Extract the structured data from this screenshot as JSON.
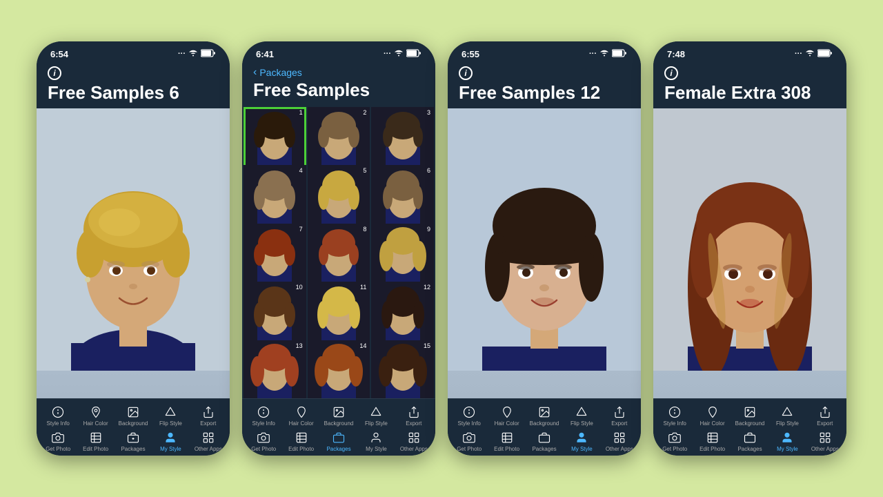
{
  "background_color": "#d4e8a0",
  "phones": [
    {
      "id": "phone1",
      "status_time": "6:54",
      "status_signal": "···",
      "status_wifi": "wifi",
      "status_battery": "battery",
      "has_back_nav": false,
      "info_icon": true,
      "title": "Free Samples 6",
      "active_tab": "my-style",
      "content_type": "photo",
      "toolbar_top": [
        {
          "icon": "info",
          "label": "Style Info"
        },
        {
          "icon": "bucket",
          "label": "Hair Color"
        },
        {
          "icon": "photo",
          "label": "Background"
        },
        {
          "icon": "flip",
          "label": "Flip Style"
        },
        {
          "icon": "share",
          "label": "Export"
        }
      ],
      "toolbar_bottom": [
        {
          "icon": "camera",
          "label": "Get Photo"
        },
        {
          "icon": "edit-photo",
          "label": "Edit Photo"
        },
        {
          "icon": "packages",
          "label": "Packages"
        },
        {
          "icon": "person",
          "label": "My Style",
          "active": true
        },
        {
          "icon": "apps",
          "label": "Other Apps"
        }
      ]
    },
    {
      "id": "phone2",
      "status_time": "6:41",
      "status_signal": "···",
      "status_wifi": "wifi",
      "status_battery": "battery",
      "has_back_nav": true,
      "back_label": "Packages",
      "info_icon": false,
      "title": "Free Samples",
      "active_tab": "packages",
      "content_type": "grid",
      "grid_items": [
        {
          "num": 1,
          "selected": true,
          "hair_style": "short",
          "hair_color": "dark"
        },
        {
          "num": 2,
          "selected": false,
          "hair_style": "short",
          "hair_color": "medium"
        },
        {
          "num": 3,
          "selected": false,
          "hair_style": "short",
          "hair_color": "dark"
        },
        {
          "num": 4,
          "selected": false,
          "hair_style": "bob",
          "hair_color": "medium"
        },
        {
          "num": 5,
          "selected": false,
          "hair_style": "bob",
          "hair_color": "blonde"
        },
        {
          "num": 6,
          "selected": false,
          "hair_style": "bob",
          "hair_color": "medium"
        },
        {
          "num": 7,
          "selected": false,
          "hair_style": "short",
          "hair_color": "auburn"
        },
        {
          "num": 8,
          "selected": false,
          "hair_style": "short",
          "hair_color": "auburn"
        },
        {
          "num": 9,
          "selected": false,
          "hair_style": "medium",
          "hair_color": "blonde"
        },
        {
          "num": 10,
          "selected": false,
          "hair_style": "bob",
          "hair_color": "brown"
        },
        {
          "num": 11,
          "selected": false,
          "hair_style": "bob",
          "hair_color": "blonde"
        },
        {
          "num": 12,
          "selected": false,
          "hair_style": "bob",
          "hair_color": "dark"
        },
        {
          "num": 13,
          "selected": false,
          "hair_style": "medium",
          "hair_color": "auburn"
        },
        {
          "num": 14,
          "selected": false,
          "hair_style": "medium",
          "hair_color": "auburn"
        },
        {
          "num": 15,
          "selected": false,
          "hair_style": "medium",
          "hair_color": "dark"
        }
      ],
      "toolbar_top": [
        {
          "icon": "info",
          "label": "Style Info"
        },
        {
          "icon": "bucket",
          "label": "Hair Color"
        },
        {
          "icon": "photo",
          "label": "Background"
        },
        {
          "icon": "flip",
          "label": "Flip Style"
        },
        {
          "icon": "share",
          "label": "Export"
        }
      ],
      "toolbar_bottom": [
        {
          "icon": "camera",
          "label": "Get Photo"
        },
        {
          "icon": "edit-photo",
          "label": "Edit Photo"
        },
        {
          "icon": "packages",
          "label": "Packages",
          "active": true
        },
        {
          "icon": "person",
          "label": "My Style"
        },
        {
          "icon": "apps",
          "label": "Other Apps"
        }
      ]
    },
    {
      "id": "phone3",
      "status_time": "6:55",
      "status_signal": "···",
      "status_wifi": "wifi",
      "status_battery": "battery",
      "has_back_nav": false,
      "info_icon": true,
      "title": "Free Samples 12",
      "active_tab": "my-style",
      "content_type": "photo",
      "toolbar_top": [
        {
          "icon": "info",
          "label": "Style Info"
        },
        {
          "icon": "bucket",
          "label": "Hair Color"
        },
        {
          "icon": "photo",
          "label": "Background"
        },
        {
          "icon": "flip",
          "label": "Flip Style"
        },
        {
          "icon": "share",
          "label": "Export"
        }
      ],
      "toolbar_bottom": [
        {
          "icon": "camera",
          "label": "Get Photo"
        },
        {
          "icon": "edit-photo",
          "label": "Edit Photo"
        },
        {
          "icon": "packages",
          "label": "Packages"
        },
        {
          "icon": "person",
          "label": "My Style",
          "active": true
        },
        {
          "icon": "apps",
          "label": "Other Apps"
        }
      ]
    },
    {
      "id": "phone4",
      "status_time": "7:48",
      "status_signal": "···",
      "status_wifi": "wifi",
      "status_battery": "battery",
      "has_back_nav": false,
      "info_icon": true,
      "title": "Female Extra 308",
      "active_tab": "my-style",
      "content_type": "photo",
      "toolbar_top": [
        {
          "icon": "info",
          "label": "Style Info"
        },
        {
          "icon": "bucket",
          "label": "Hair Color"
        },
        {
          "icon": "photo",
          "label": "Background"
        },
        {
          "icon": "flip",
          "label": "Flip Style"
        },
        {
          "icon": "share",
          "label": "Export"
        }
      ],
      "toolbar_bottom": [
        {
          "icon": "camera",
          "label": "Get Photo"
        },
        {
          "icon": "edit-photo",
          "label": "Edit Photo"
        },
        {
          "icon": "packages",
          "label": "Packages"
        },
        {
          "icon": "person",
          "label": "My Style",
          "active": true
        },
        {
          "icon": "apps",
          "label": "Other Apps"
        }
      ]
    }
  ]
}
